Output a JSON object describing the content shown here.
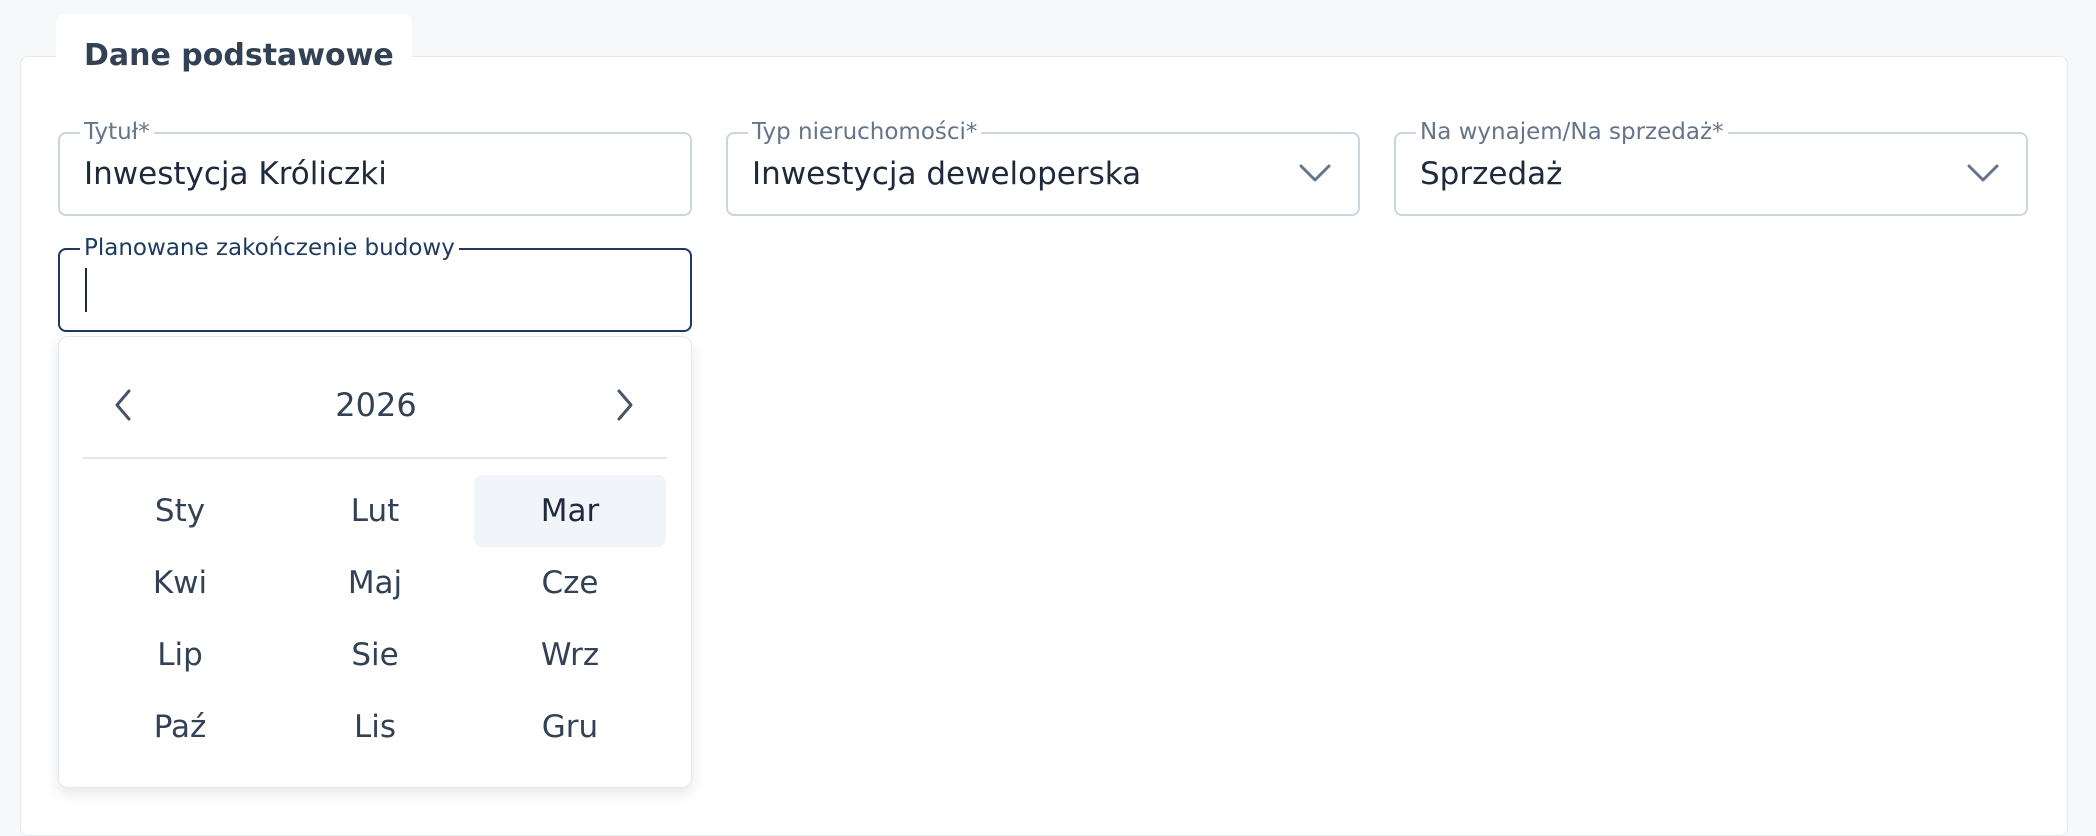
{
  "section": {
    "title": "Dane podstawowe"
  },
  "fields": {
    "title": {
      "label": "Tytuł*",
      "value": "Inwestycja Króliczki"
    },
    "property_type": {
      "label": "Typ nieruchomości*",
      "value": "Inwestycja deweloperska"
    },
    "offer_type": {
      "label": "Na wynajem/Na sprzedaż*",
      "value": "Sprzedaż"
    },
    "completion": {
      "label": "Planowane zakończenie budowy",
      "value": ""
    }
  },
  "picker": {
    "year": "2026",
    "months": [
      "Sty",
      "Lut",
      "Mar",
      "Kwi",
      "Maj",
      "Cze",
      "Lip",
      "Sie",
      "Wrz",
      "Paź",
      "Lis",
      "Gru"
    ],
    "highlighted_month": "Mar"
  },
  "icons": {
    "dropdown": "chevron-down-icon",
    "prev": "chevron-left-icon",
    "next": "chevron-right-icon"
  },
  "colors": {
    "focus_border": "#1e3a5f",
    "input_border": "#cbd5e1",
    "highlight": "#f1f4f9"
  }
}
